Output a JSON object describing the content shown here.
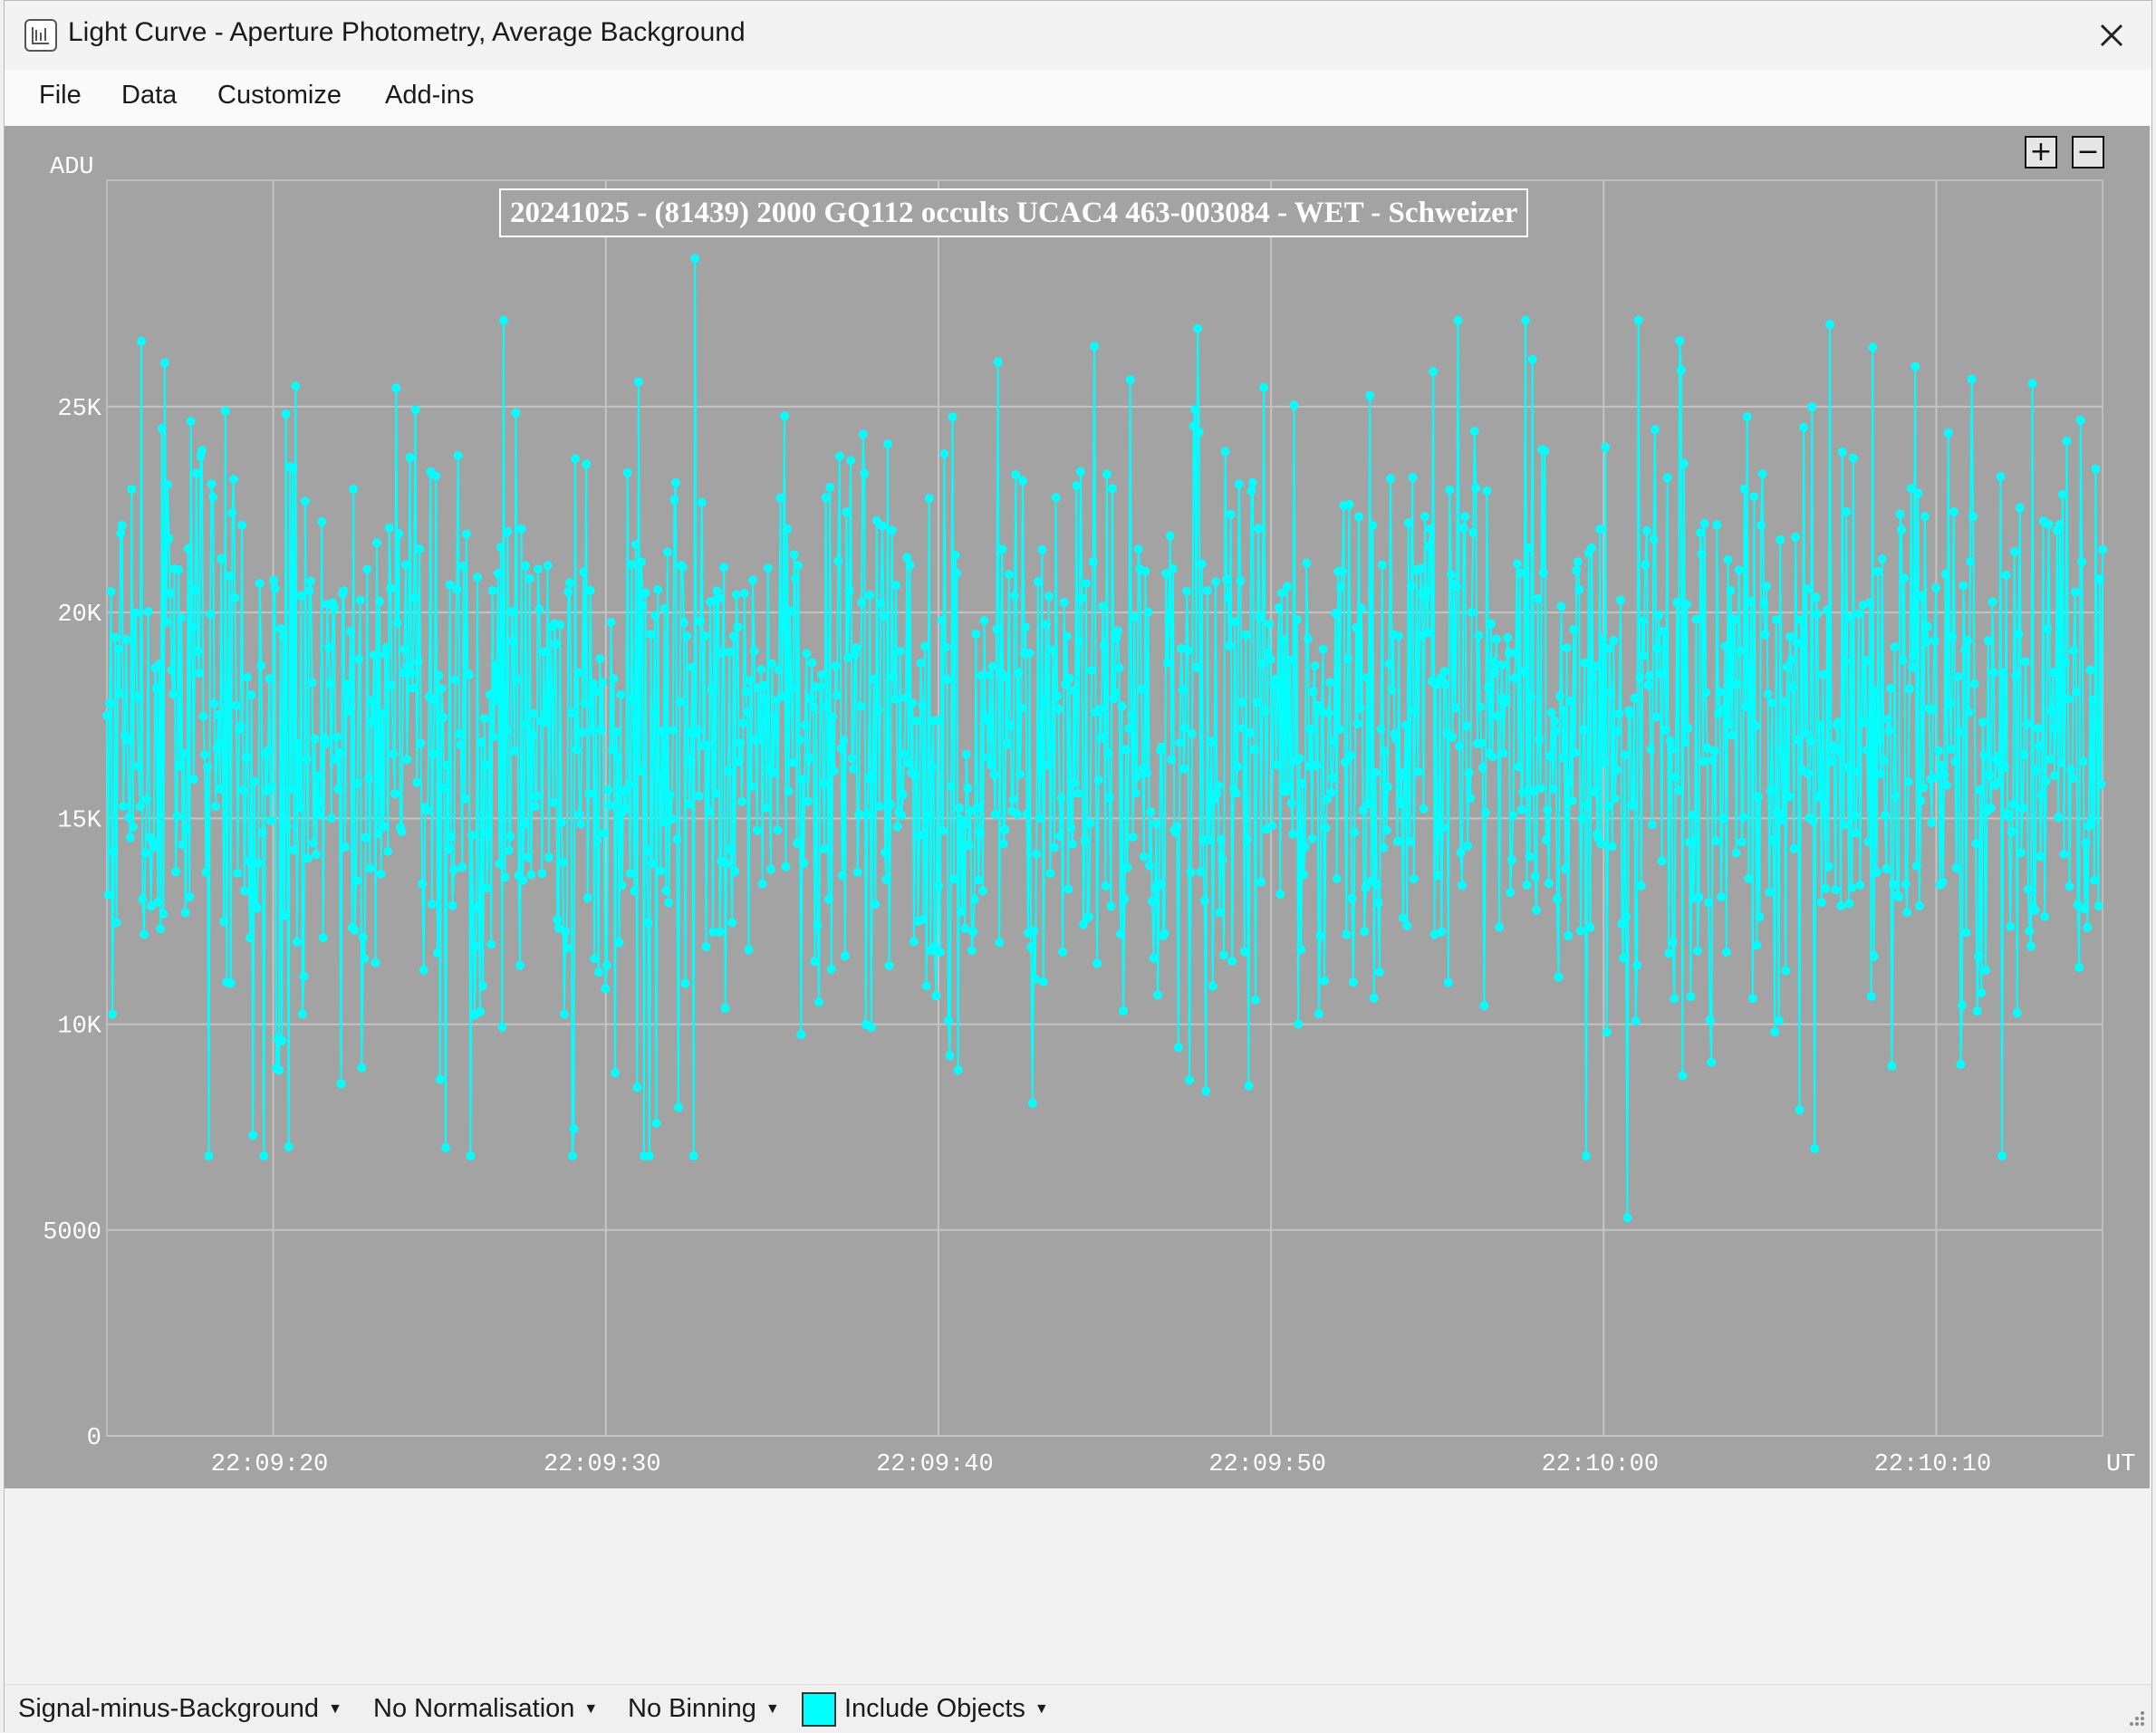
{
  "window": {
    "title": "Light Curve - Aperture Photometry, Average Background",
    "icon": "light-curve-app-icon",
    "close_icon": "close-icon"
  },
  "menu": {
    "items": [
      "File",
      "Data",
      "Customize",
      "Add-ins"
    ]
  },
  "plot": {
    "zoom_in": "+",
    "zoom_out": "−"
  },
  "chart_data": {
    "type": "line",
    "title": "20241025 - (81439) 2000 GQ112 occults UCAC4 463-003084 - WET - Schweizer",
    "ylabel": "ADU",
    "xlabel": "UT",
    "x_ticks": [
      "22:09:20",
      "22:09:30",
      "22:09:40",
      "22:09:50",
      "22:10:00",
      "22:10:10"
    ],
    "x_range_seconds": [
      -5,
      55
    ],
    "y_ticks": [
      {
        "value": 0,
        "label": "0"
      },
      {
        "value": 5000,
        "label": "5000"
      },
      {
        "value": 10000,
        "label": "10K"
      },
      {
        "value": 15000,
        "label": "15K"
      },
      {
        "value": 20000,
        "label": "20K"
      },
      {
        "value": 25000,
        "label": "25K"
      }
    ],
    "ylim": [
      0,
      30500
    ],
    "grid": true,
    "series": [
      {
        "color": "#00ffff",
        "marker": "circle",
        "points_count": 1450,
        "mean": 17000,
        "min": 5300,
        "max": 28600,
        "notable_points": [
          {
            "x_seconds": 12.7,
            "y": 28600
          },
          {
            "x_seconds": 40.7,
            "y": 5300
          },
          {
            "x_seconds": 5.2,
            "y": 7000
          },
          {
            "x_seconds": -0.6,
            "y": 7300
          },
          {
            "x_seconds": 46.8,
            "y": 27000
          },
          {
            "x_seconds": 42.3,
            "y": 26600
          },
          {
            "x_seconds": 27.8,
            "y": 26900
          }
        ]
      }
    ]
  },
  "status": {
    "measurement": "Signal-minus-Background",
    "normalisation": "No Normalisation",
    "binning": "No Binning",
    "objects": "Include Objects",
    "objects_color": "#00ffff"
  }
}
